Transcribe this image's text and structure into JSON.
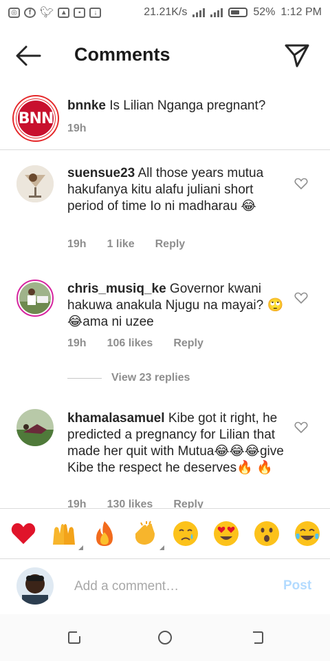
{
  "status_bar": {
    "speed": "21.21K/s",
    "battery": "52%",
    "time": "1:12 PM"
  },
  "header": {
    "title": "Comments"
  },
  "caption": {
    "username": "bnnke",
    "text": "Is Lilian Nganga pregnant?",
    "time": "19h",
    "avatar_text": "BNN"
  },
  "comments": [
    {
      "username": "suensue23",
      "text": "All those years mutua hakufanya kitu alafu juliani short period of time Io ni madharau",
      "emoji": "😂",
      "time": "19h",
      "likes": "1 like",
      "reply": "Reply"
    },
    {
      "username": "chris_musiq_ke",
      "text": "Governor kwani hakuwa anakula Njugu na mayai?",
      "emoji": "🙄😂",
      "text_after": "ama ni uzee",
      "time": "19h",
      "likes": "106 likes",
      "reply": "Reply",
      "view_replies": "View 23 replies"
    },
    {
      "username": "khamalasamuel",
      "text": "Kibe got it right, he predicted a pregnancy for Lilian that made her quit with Mutua",
      "emoji": "😂😂😂",
      "text_after": "give Kibe the respect he deserves",
      "emoji_after": "🔥 🔥",
      "time": "19h",
      "likes": "130 likes",
      "reply": "Reply"
    }
  ],
  "emoji_bar": [
    "heart-emoji",
    "raised-hands-emoji",
    "fire-emoji",
    "clapping-emoji",
    "crying-emoji",
    "heart-eyes-emoji",
    "surprised-emoji",
    "tears-of-joy-emoji"
  ],
  "add_comment": {
    "placeholder": "Add a comment…",
    "post_label": "Post"
  },
  "colors": {
    "text": "#262626",
    "muted": "#8e8e8e",
    "post_disabled": "#b3dbff",
    "bnn_red": "#e52729"
  }
}
